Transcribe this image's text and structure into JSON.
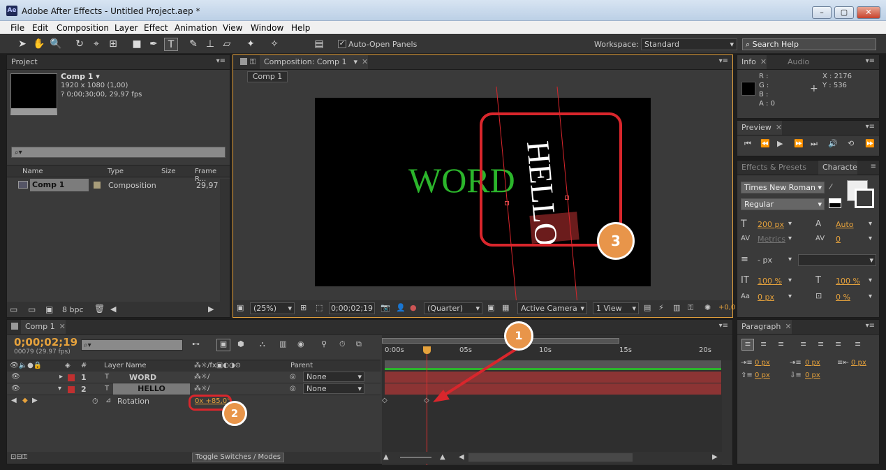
{
  "window": {
    "app_icon": "Ae",
    "title": "Adobe After Effects - Untitled Project.aep *"
  },
  "menu": [
    "File",
    "Edit",
    "Composition",
    "Layer",
    "Effect",
    "Animation",
    "View",
    "Window",
    "Help"
  ],
  "toolbar": {
    "auto_open": "Auto-Open Panels",
    "workspace_label": "Workspace:",
    "workspace": "Standard",
    "search_help": "Search Help"
  },
  "project": {
    "tab": "Project",
    "comp_name": "Comp 1 ▾",
    "comp_size": "1920 x 1080 (1,00)",
    "comp_duration": "? 0;00;30;00, 29,97 fps",
    "search_placeholder": "",
    "columns": [
      "Name",
      "Type",
      "Size",
      "Frame R..."
    ],
    "items": [
      {
        "name": "Comp 1",
        "type": "Composition",
        "fps": "29,97"
      }
    ],
    "bpc": "8 bpc"
  },
  "composition": {
    "tab": "Composition: Comp 1",
    "subtab": "Comp 1",
    "text_word": "WORD",
    "text_hello": "HELLO",
    "zoom": "(25%)",
    "timecode": "0;00;02;19",
    "resolution": "(Quarter)",
    "camera": "Active Camera",
    "views": "1 View",
    "exposure": "+0,0"
  },
  "info": {
    "tab": "Info",
    "tab2": "Audio",
    "r": "R :",
    "g": "G :",
    "b": "B :",
    "a": "A : 0",
    "x": "X : 2176",
    "y": "Y : 536"
  },
  "preview": {
    "tab": "Preview"
  },
  "effects": {
    "tab": "Effects & Presets",
    "tab2": "Characte"
  },
  "character": {
    "font": "Times New Roman",
    "style": "Regular",
    "size": "200 px",
    "leading": "Auto",
    "kerning": "Metrics",
    "tracking": "0",
    "stroke": "- px",
    "vscale": "100 %",
    "hscale": "100 %",
    "baseline": "0 px",
    "tsume": "0 %"
  },
  "paragraph": {
    "tab": "Paragraph",
    "indent_left": "0 px",
    "indent_first": "0 px",
    "indent_right": "0 px",
    "space_before": "0 px",
    "space_after": "0 px"
  },
  "timeline": {
    "tab": "Comp 1",
    "timecode": "0;00;02;19",
    "frame": "00079 (29.97 fps)",
    "col_layer_name": "Layer Name",
    "col_parent": "Parent",
    "col_num": "#",
    "layers": [
      {
        "num": "1",
        "name": "WORD",
        "parent": "None"
      },
      {
        "num": "2",
        "name": "HELLO",
        "parent": "None"
      }
    ],
    "rotation_label": "Rotation",
    "rotation_value": "0x +85,0°",
    "ruler": [
      "0:00s",
      "05s",
      "10s",
      "15s",
      "20s"
    ],
    "toggle": "Toggle Switches / Modes"
  },
  "annotations": {
    "one": "1",
    "two": "2",
    "three": "3"
  },
  "colors": {
    "accent": "#e6a23c",
    "red_annot": "#d9262c",
    "badge": "#e8954a",
    "word": "#2bb52b"
  }
}
